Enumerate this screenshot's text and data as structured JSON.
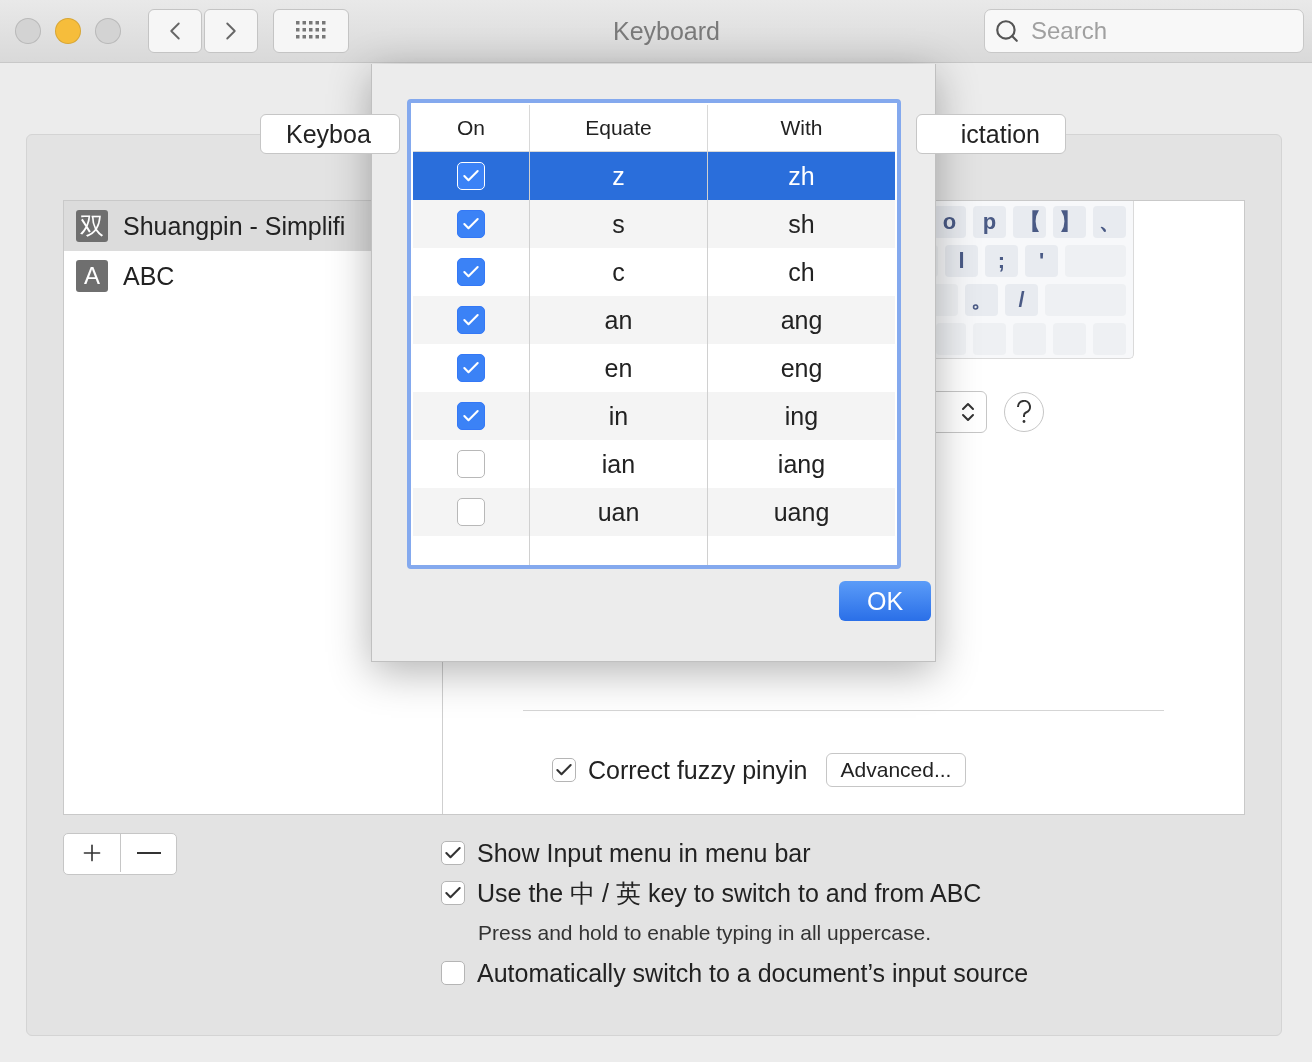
{
  "window": {
    "title": "Keyboard",
    "search": {
      "placeholder": "Search"
    }
  },
  "tabs": [
    {
      "label": "Keyboa",
      "selected": false
    },
    {
      "label": "ictation",
      "selected": false
    }
  ],
  "input_sources": [
    {
      "icon": "双",
      "name": "Shuangpin - Simplifi",
      "selected": true
    },
    {
      "icon": "A",
      "name": "ABC",
      "selected": false
    }
  ],
  "keyboard_preview": {
    "rows": [
      [
        "o",
        "p",
        "【",
        "】",
        "、"
      ],
      [
        "l",
        ";",
        "'"
      ],
      [
        "。",
        "/"
      ]
    ]
  },
  "pinyin_options": [
    {
      "label": "Correct fuzzy pinyin",
      "checked": true,
      "button": "Advanced..."
    }
  ],
  "options": [
    {
      "kind": "checkbox",
      "label": "Show Input menu in menu bar",
      "checked": true
    },
    {
      "kind": "checkbox",
      "label": "Use the 中 / 英 key to switch to and from ABC",
      "checked": true
    },
    {
      "kind": "hint",
      "label": "Press and hold to enable typing in all uppercase."
    },
    {
      "kind": "checkbox",
      "label": "Automatically switch to a document’s input source",
      "checked": false
    }
  ],
  "dialog": {
    "columns": [
      "On",
      "Equate",
      "With"
    ],
    "rows": [
      {
        "on": true,
        "equate": "z",
        "with": "zh",
        "selected": true
      },
      {
        "on": true,
        "equate": "s",
        "with": "sh",
        "selected": false
      },
      {
        "on": true,
        "equate": "c",
        "with": "ch",
        "selected": false
      },
      {
        "on": true,
        "equate": "an",
        "with": "ang",
        "selected": false
      },
      {
        "on": true,
        "equate": "en",
        "with": "eng",
        "selected": false
      },
      {
        "on": true,
        "equate": "in",
        "with": "ing",
        "selected": false
      },
      {
        "on": false,
        "equate": "ian",
        "with": "iang",
        "selected": false
      },
      {
        "on": false,
        "equate": "uan",
        "with": "uang",
        "selected": false
      }
    ],
    "button": "OK"
  }
}
